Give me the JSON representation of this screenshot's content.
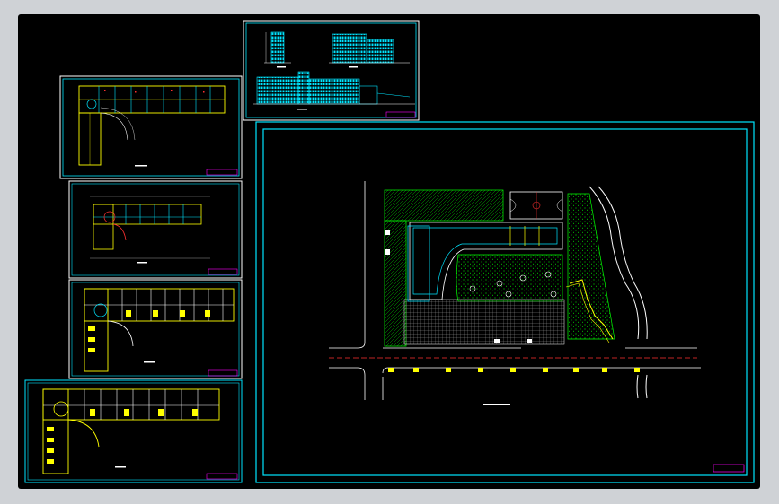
{
  "colors": {
    "frame": "#00e5ff",
    "wall": "#ffff00",
    "hatch": "#00ff00",
    "road": "#ffffff",
    "dim": "#ff3030",
    "accent": "#ff00ff",
    "background": "#000000"
  },
  "sheets": [
    {
      "name": "elevation-sheet",
      "title": ""
    },
    {
      "name": "roof-plan-sheet",
      "title": ""
    },
    {
      "name": "floor-plan-sheet-a",
      "title": ""
    },
    {
      "name": "floor-plan-sheet-b",
      "title": ""
    },
    {
      "name": "floor-plan-sheet-c",
      "title": ""
    },
    {
      "name": "site-plan-sheet",
      "title": ""
    }
  ]
}
